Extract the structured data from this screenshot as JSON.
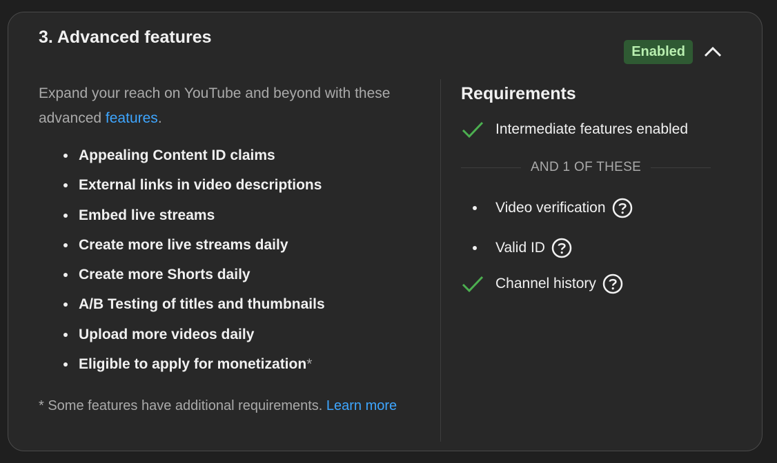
{
  "section": {
    "title": "3. Advanced features",
    "status_badge": "Enabled",
    "collapse_icon": "chevron-up-icon"
  },
  "left": {
    "intro_text": "Expand your reach on YouTube and beyond with these advanced ",
    "intro_link": "features",
    "intro_end": ".",
    "features": [
      "Appealing Content ID claims",
      "External links in video descriptions",
      "Embed live streams",
      "Create more live streams daily",
      "Create more Shorts daily",
      "A/B Testing of titles and thumbnails",
      "Upload more videos daily",
      "Eligible to apply for monetization"
    ],
    "last_feature_suffix": "*",
    "footnote_text": "* Some features have additional requirements. ",
    "footnote_link": "Learn more"
  },
  "requirements": {
    "title": "Requirements",
    "primary": {
      "label": "Intermediate features enabled",
      "status": "met"
    },
    "separator": "AND 1 OF THESE",
    "options": [
      {
        "label": "Video verification",
        "status": "not-met",
        "help_icon": "help-icon"
      },
      {
        "label": "Valid ID",
        "status": "not-met",
        "help_icon": "help-icon"
      },
      {
        "label": "Channel history",
        "status": "met",
        "help_icon": "help-icon"
      }
    ]
  },
  "colors": {
    "accent_link": "#3ea6ff",
    "badge_bg": "#2f5a33",
    "badge_text": "#b9efb0",
    "check_green": "#4caf50"
  }
}
